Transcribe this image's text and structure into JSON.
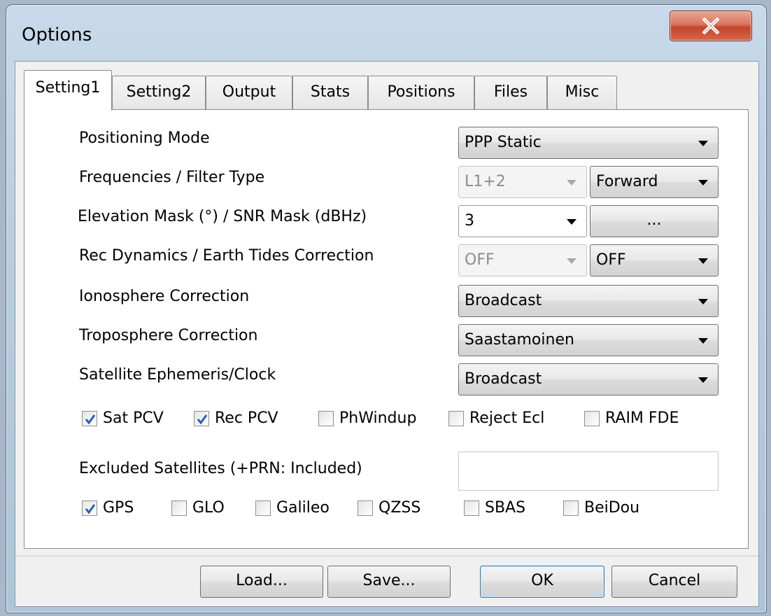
{
  "window": {
    "title": "Options"
  },
  "tabs": [
    {
      "label": "Setting1",
      "active": true
    },
    {
      "label": "Setting2",
      "active": false
    },
    {
      "label": "Output",
      "active": false
    },
    {
      "label": "Stats",
      "active": false
    },
    {
      "label": "Positions",
      "active": false
    },
    {
      "label": "Files",
      "active": false
    },
    {
      "label": "Misc",
      "active": false
    }
  ],
  "rows": [
    {
      "label": "Positioning Mode",
      "value1": "PPP Static"
    },
    {
      "label": "Frequencies / Filter Type",
      "value1": "L1+2",
      "value2": "Forward"
    },
    {
      "label": "Elevation Mask (°) / SNR Mask (dBHz)",
      "value1": "3",
      "value2": "..."
    },
    {
      "label": "Rec Dynamics / Earth Tides Correction",
      "value1": "OFF",
      "value2": "OFF"
    },
    {
      "label": "Ionosphere Correction",
      "value1": "Broadcast"
    },
    {
      "label": "Troposphere Correction",
      "value1": "Saastamoinen"
    },
    {
      "label": "Satellite Ephemeris/Clock",
      "value1": "Broadcast"
    }
  ],
  "options": [
    {
      "label": "Sat PCV",
      "checked": true
    },
    {
      "label": "Rec PCV",
      "checked": true
    },
    {
      "label": "PhWindup",
      "checked": false
    },
    {
      "label": "Reject Ecl",
      "checked": false
    },
    {
      "label": "RAIM FDE",
      "checked": false
    }
  ],
  "excluded": {
    "label": "Excluded Satellites (+PRN: Included)",
    "value": ""
  },
  "systems": [
    {
      "label": "GPS",
      "checked": true
    },
    {
      "label": "GLO",
      "checked": false
    },
    {
      "label": "Galileo",
      "checked": false
    },
    {
      "label": "QZSS",
      "checked": false
    },
    {
      "label": "SBAS",
      "checked": false
    },
    {
      "label": "BeiDou",
      "checked": false
    }
  ],
  "buttons": {
    "load": "Load...",
    "save": "Save...",
    "ok": "OK",
    "cancel": "Cancel"
  },
  "icons": {
    "close": "close-icon",
    "dropdown": "chevron-down-icon",
    "check": "checkmark-icon"
  },
  "colors": {
    "close_red": "#c4452b",
    "check_blue": "#2a5fb0",
    "default_button_border": "#3c7fb1"
  }
}
